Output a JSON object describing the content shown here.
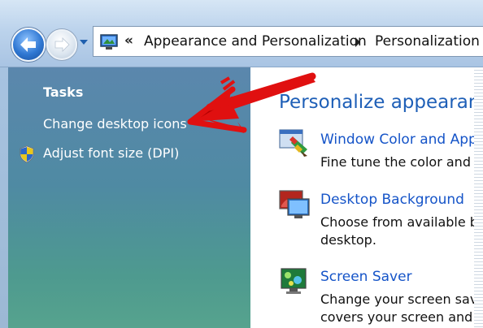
{
  "address": {
    "overflow_chevrons": "«",
    "crumbs": [
      "Appearance and Personalization",
      "Personalization"
    ]
  },
  "sidebar": {
    "heading": "Tasks",
    "links": [
      {
        "label": "Change desktop icons",
        "icon": "none"
      },
      {
        "label": "Adjust font size (DPI)",
        "icon": "uac-shield-icon"
      }
    ]
  },
  "main": {
    "title": "Personalize appearance a",
    "items": [
      {
        "link": "Window Color and Appea",
        "desc": [
          "Fine tune the color and st"
        ],
        "icon": "window-color-icon"
      },
      {
        "link": "Desktop Background",
        "desc": [
          "Choose from available ba",
          "desktop."
        ],
        "icon": "desktop-background-icon"
      },
      {
        "link": "Screen Saver",
        "desc": [
          "Change your screen saver",
          "covers your screen and ap"
        ],
        "icon": "screen-saver-icon"
      }
    ]
  },
  "annotation": {
    "color": "#e01010",
    "points_to": "Change desktop icons"
  }
}
